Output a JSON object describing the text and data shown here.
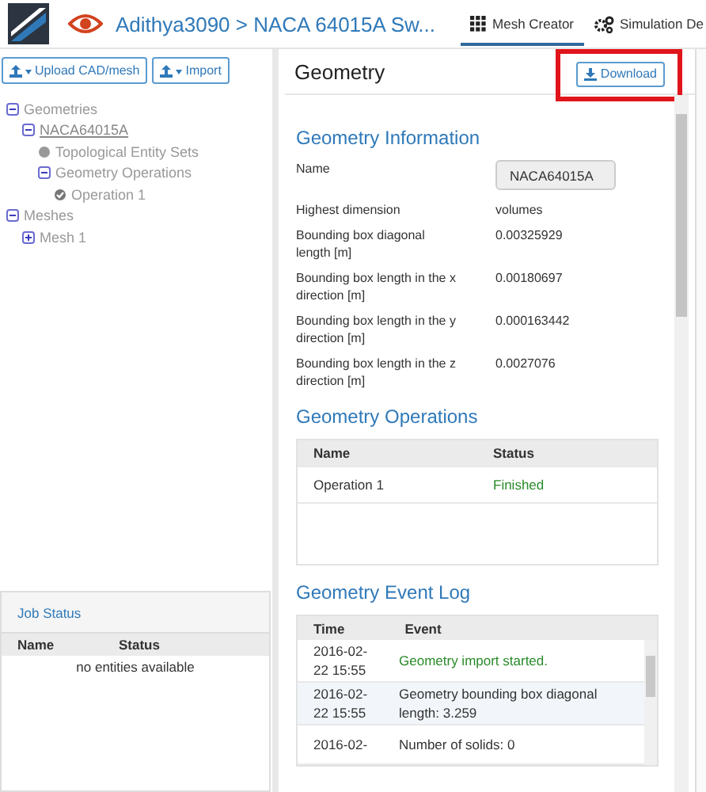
{
  "header": {
    "breadcrumb": "Adithya3090 > NACA 64015A Sw...",
    "tabs": [
      {
        "label": "Mesh Creator",
        "kind": "grid",
        "selected": true
      },
      {
        "label": "Simulation De",
        "kind": "gears",
        "selected": false
      }
    ]
  },
  "sidebar": {
    "buttons": [
      "Upload CAD/mesh",
      "Import"
    ],
    "tree": [
      {
        "label": "Geometries",
        "kind": "group",
        "expanded": true,
        "children": [
          {
            "label": "NACA64015A",
            "kind": "group",
            "expanded": true,
            "children": [
              {
                "label": "Topological Entity Sets",
                "kind": "set"
              },
              {
                "label": "Geometry Operations",
                "kind": "group",
                "expanded": true,
                "children": [
                  {
                    "label": "Operation 1",
                    "kind": "done"
                  }
                ]
              }
            ]
          }
        ]
      },
      {
        "label": "Meshes",
        "kind": "group",
        "expanded": true,
        "children": [
          {
            "label": "Mesh 1",
            "kind": "group",
            "expanded": false
          }
        ]
      }
    ],
    "job_status": {
      "title": "Job Status",
      "columns": [
        "Name",
        "Status"
      ],
      "empty": "no entities available"
    }
  },
  "panel": {
    "title": "Geometry",
    "download": "Download",
    "info": {
      "title": "Geometry Information",
      "rows": [
        {
          "label": "Name",
          "value": "NACA64015A",
          "kind": "field"
        },
        {
          "label": "Highest dimension",
          "value": "volumes",
          "kind": "text"
        },
        {
          "label": "Bounding box diagonal length [m]",
          "value": "0.00325929",
          "kind": "text"
        },
        {
          "label": "Bounding box length in the x direction [m]",
          "value": "0.00180697",
          "kind": "text"
        },
        {
          "label": "Bounding box length in the y direction [m]",
          "value": "0.000163442",
          "kind": "text"
        },
        {
          "label": "Bounding box length in the z direction [m]",
          "value": "0.0027076",
          "kind": "text"
        }
      ]
    },
    "operations": {
      "title": "Geometry Operations",
      "columns": [
        "Name",
        "Status"
      ],
      "rows": [
        {
          "name": "Operation 1",
          "status": "Finished"
        }
      ]
    },
    "log": {
      "title": "Geometry Event Log",
      "columns": [
        "Time",
        "Event"
      ],
      "rows": [
        {
          "time": "2016-02-22 15:55",
          "event": "Geometry import started.",
          "kind": "success",
          "selected": false
        },
        {
          "time": "2016-02-22 15:55",
          "event": "Geometry bounding box diagonal length: 3.259",
          "kind": "info",
          "selected": true
        },
        {
          "time": "2016-02-",
          "event": "Number of solids: 0",
          "kind": "info",
          "selected": false
        }
      ]
    }
  }
}
